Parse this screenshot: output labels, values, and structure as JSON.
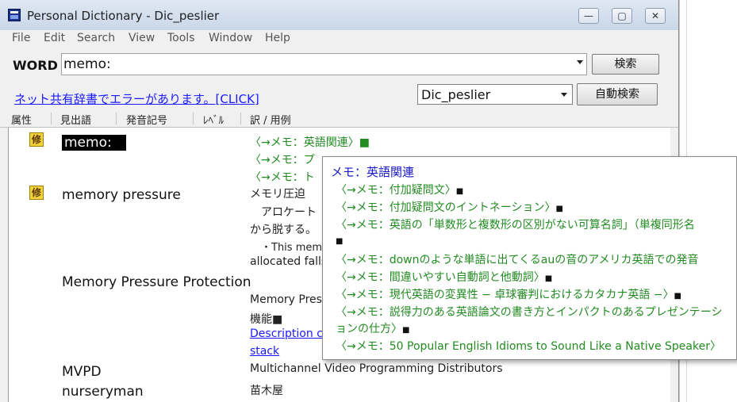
{
  "window": {
    "title": "Personal Dictionary - Dic_peslier",
    "controls": {
      "minimize": "—",
      "maximize": "▢",
      "close": "✕"
    }
  },
  "menu": [
    "File",
    "Edit",
    "Search",
    "View",
    "Tools",
    "Window",
    "Help"
  ],
  "search": {
    "label": "WORD",
    "value": "memo:",
    "search_button": "検索"
  },
  "status": {
    "error_link": "ネット共有辞書でエラーがあります。[CLICK]",
    "dictionary": "Dic_peslier",
    "auto_search_button": "自動検索"
  },
  "columns": [
    "属性",
    "見出語",
    "発音記号",
    "ﾚﾍﾞﾙ",
    "訳 / 用例"
  ],
  "entries": [
    {
      "badge": "修",
      "headword": "memo:",
      "lines": [
        "〈→メモ：英語関連〉■",
        "〈→メモ：プ",
        "〈→メモ：ト"
      ]
    },
    {
      "badge": "修",
      "headword": "memory pressure",
      "lines": [
        "メモリ圧迫",
        "アロケート",
        "から脱する。",
        "・This mem",
        "allocated falls"
      ]
    },
    {
      "headword": "Memory Pressure Protection",
      "lines": [
        "Memory Pres",
        "機能■",
        "Description c",
        "stack"
      ]
    },
    {
      "headword": "MVPD",
      "lines": [
        "Multichannel Video Programming Distributors"
      ]
    },
    {
      "headword": "nurseryman",
      "lines": [
        "苗木屋"
      ]
    }
  ],
  "popup": {
    "title": "メモ：英語関連",
    "lines": [
      "〈→メモ：付加疑問文〉",
      "〈→メモ：付加疑問文のイントネーション〉",
      "〈→メモ：英語の「単数形と複数形の区別がない可算名詞」（単複同形名",
      "",
      "〈→メモ：downのような単語に出てくるauの音のアメリカ英語での発音",
      "〈→メモ：間違いやすい自動詞と他動詞〉",
      "〈→メモ：現代英語の変異性 − 卓球審判におけるカタカナ英語 −〉",
      "〈→メモ：説得力のある英語論文の書き方とインパクトのあるプレゼンテーシ",
      "ョンの仕方〉",
      "〈→メモ：50 Popular English Idioms to Sound Like a Native Speaker〉"
    ],
    "end_mark": "■"
  },
  "colors": {
    "translation_green": "#228b22",
    "link_blue": "#1a1aff",
    "badge_yellow": "#f4d23a"
  }
}
